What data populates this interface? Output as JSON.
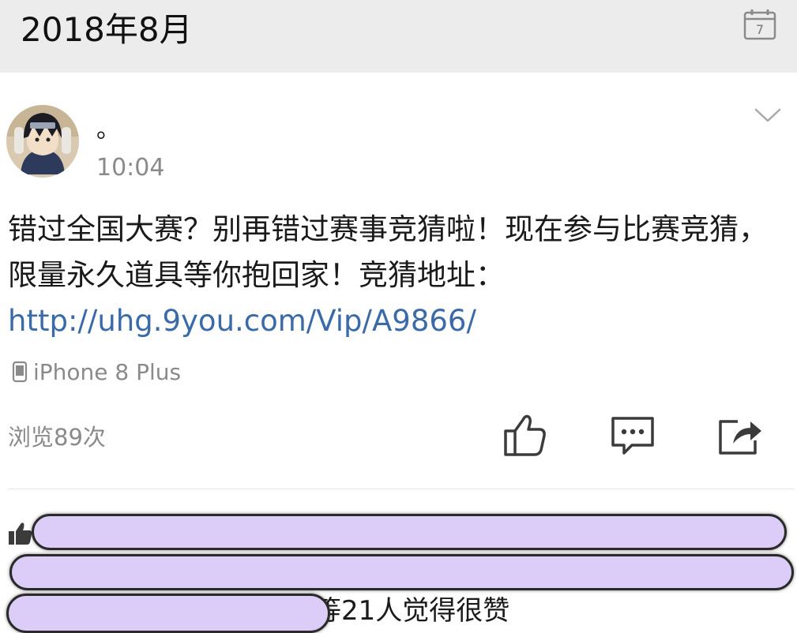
{
  "header": {
    "month_title": "2018年8月",
    "calendar_day": "7"
  },
  "post": {
    "author_name": "。",
    "time": "10:04",
    "text": "错过全国大赛？别再错过赛事竞猜啦！现在参与比赛竞猜，限量永久道具等你抱回家！竞猜地址：",
    "link": "http://uhg.9you.com/Vip/A9866/",
    "device": "iPhone 8 Plus",
    "views": "浏览89次"
  },
  "likes": {
    "summary_tail": "等21人觉得很赞"
  },
  "colors": {
    "link": "#3a6aa8",
    "header_bg": "#ececec",
    "muted": "#8a8a8a",
    "redaction": "#dcccf8"
  },
  "icons": [
    "calendar-icon",
    "chevron-down-icon",
    "phone-icon",
    "like-icon",
    "comment-icon",
    "share-icon",
    "thumbs-up-icon"
  ]
}
